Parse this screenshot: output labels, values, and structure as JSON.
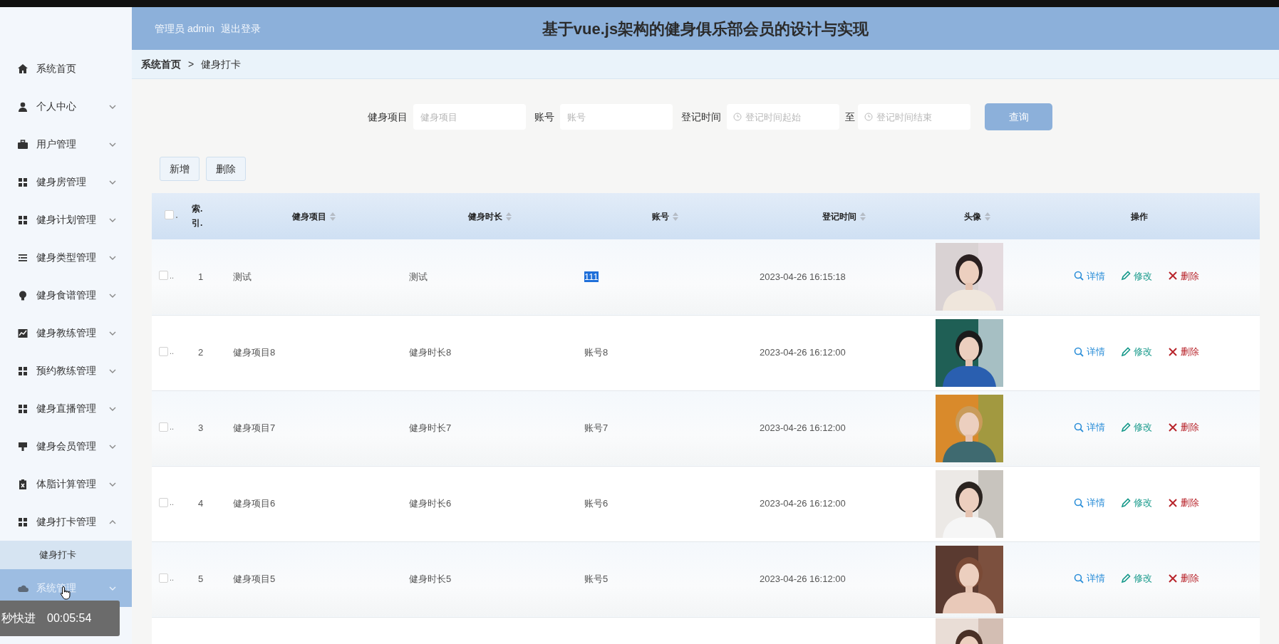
{
  "header": {
    "user_label": "管理员 admin",
    "logout": "退出登录",
    "title": "基于vue.js架构的健身俱乐部会员的设计与实现"
  },
  "sidebar": {
    "items": [
      {
        "label": "系统首页",
        "expandable": false,
        "hovered": false
      },
      {
        "label": "个人中心",
        "expandable": true,
        "expanded": false,
        "hovered": false
      },
      {
        "label": "用户管理",
        "expandable": true,
        "expanded": false,
        "hovered": false
      },
      {
        "label": "健身房管理",
        "expandable": true,
        "expanded": false,
        "hovered": false
      },
      {
        "label": "健身计划管理",
        "expandable": true,
        "expanded": false,
        "hovered": false
      },
      {
        "label": "健身类型管理",
        "expandable": true,
        "expanded": false,
        "hovered": false
      },
      {
        "label": "健身食谱管理",
        "expandable": true,
        "expanded": false,
        "hovered": false
      },
      {
        "label": "健身教练管理",
        "expandable": true,
        "expanded": false,
        "hovered": false
      },
      {
        "label": "预约教练管理",
        "expandable": true,
        "expanded": false,
        "hovered": false
      },
      {
        "label": "健身直播管理",
        "expandable": true,
        "expanded": false,
        "hovered": false
      },
      {
        "label": "健身会员管理",
        "expandable": true,
        "expanded": false,
        "hovered": false
      },
      {
        "label": "体脂计算管理",
        "expandable": true,
        "expanded": false,
        "hovered": false
      },
      {
        "label": "健身打卡管理",
        "expandable": true,
        "expanded": true,
        "hovered": false,
        "children": [
          {
            "label": "健身打卡",
            "selected": true
          }
        ]
      },
      {
        "label": "系统管理",
        "expandable": true,
        "expanded": false,
        "hovered": true
      }
    ]
  },
  "breadcrumb": {
    "items": [
      "系统首页",
      "健身打卡"
    ],
    "separator": ">"
  },
  "filters": [
    {
      "kind": "text",
      "label": "健身项目",
      "placeholder": "健身项目"
    },
    {
      "kind": "text",
      "label": "账号",
      "placeholder": "账号"
    },
    {
      "kind": "date_range",
      "label": "登记时间",
      "placeholder": "登记时间起始",
      "range_separator": "至",
      "placeholder_end": "登记时间结束"
    }
  ],
  "search_button": "查询",
  "toolbar_buttons": [
    "新增",
    "删除"
  ],
  "table": {
    "header_checkbox": {
      "checked": false,
      "mark": "."
    },
    "columns": [
      {
        "label": "索.引.",
        "sortable": false
      },
      {
        "label": "健身项目",
        "sortable": true
      },
      {
        "label": "健身时长",
        "sortable": true
      },
      {
        "label": "账号",
        "sortable": true
      },
      {
        "label": "登记时间",
        "sortable": true
      },
      {
        "label": "头像",
        "sortable": true
      },
      {
        "label": "操作",
        "sortable": false
      }
    ],
    "rows": [
      {
        "checked": false,
        "mark": "..",
        "index": "1",
        "project": "测试",
        "duration": "测试",
        "account": "111",
        "account_highlighted": true,
        "time": "2023-04-26 16:15:18",
        "avatar": {
          "kind": "picture"
        },
        "actions": [
          {
            "kind": "view",
            "label": "详情"
          },
          {
            "kind": "edit",
            "label": "修改"
          },
          {
            "kind": "delete",
            "label": "删除"
          }
        ]
      },
      {
        "checked": false,
        "mark": "..",
        "index": "2",
        "project": "健身项目8",
        "duration": "健身时长8",
        "account": "账号8",
        "account_highlighted": false,
        "time": "2023-04-26 16:12:00",
        "avatar": {
          "kind": "picture"
        },
        "actions": [
          {
            "kind": "view",
            "label": "详情"
          },
          {
            "kind": "edit",
            "label": "修改"
          },
          {
            "kind": "delete",
            "label": "删除"
          }
        ]
      },
      {
        "checked": false,
        "mark": "..",
        "index": "3",
        "project": "健身项目7",
        "duration": "健身时长7",
        "account": "账号7",
        "account_highlighted": false,
        "time": "2023-04-26 16:12:00",
        "avatar": {
          "kind": "picture"
        },
        "actions": [
          {
            "kind": "view",
            "label": "详情"
          },
          {
            "kind": "edit",
            "label": "修改"
          },
          {
            "kind": "delete",
            "label": "删除"
          }
        ]
      },
      {
        "checked": false,
        "mark": "..",
        "index": "4",
        "project": "健身项目6",
        "duration": "健身时长6",
        "account": "账号6",
        "account_highlighted": false,
        "time": "2023-04-26 16:12:00",
        "avatar": {
          "kind": "picture"
        },
        "actions": [
          {
            "kind": "view",
            "label": "详情"
          },
          {
            "kind": "edit",
            "label": "修改"
          },
          {
            "kind": "delete",
            "label": "删除"
          }
        ]
      },
      {
        "checked": false,
        "mark": "..",
        "index": "5",
        "project": "健身项目5",
        "duration": "健身时长5",
        "account": "账号5",
        "account_highlighted": false,
        "time": "2023-04-26 16:12:00",
        "avatar": {
          "kind": "picture"
        },
        "actions": [
          {
            "kind": "view",
            "label": "详情"
          },
          {
            "kind": "edit",
            "label": "修改"
          },
          {
            "kind": "delete",
            "label": "删除"
          }
        ]
      },
      {
        "avatar": {
          "kind": "picture"
        }
      }
    ]
  },
  "player_toast": {
    "text": "秒快进",
    "time": "00:05:54"
  }
}
